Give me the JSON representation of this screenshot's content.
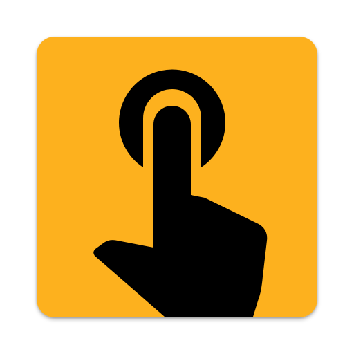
{
  "icon": {
    "name": "touch-app-icon",
    "background_color": "#FDB11E",
    "glyph_color": "#000000"
  }
}
